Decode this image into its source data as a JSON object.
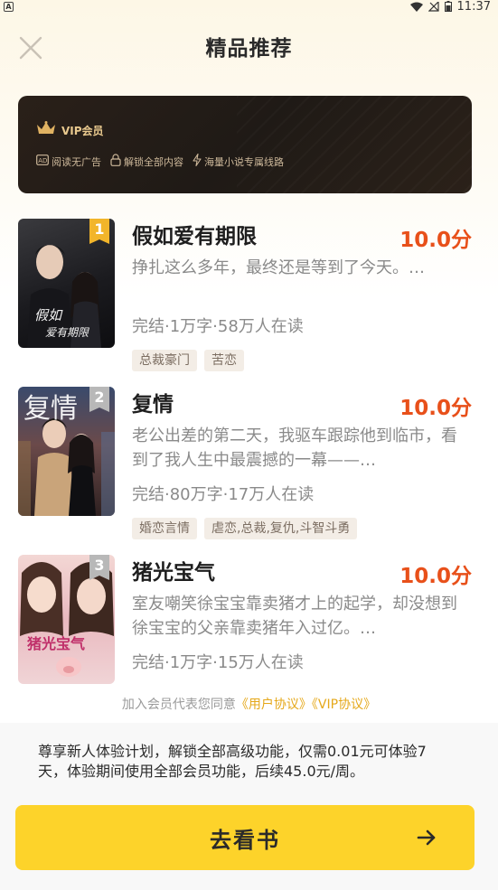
{
  "status_bar": {
    "time": "11:37",
    "notification_icon": "a-icon"
  },
  "header": {
    "title": "精品推荐",
    "close_icon": "close-icon"
  },
  "vip": {
    "title": "VIP会员",
    "perks": [
      {
        "icon": "ad-icon",
        "label": "阅读无广告"
      },
      {
        "icon": "lock-icon",
        "label": "解锁全部内容"
      },
      {
        "icon": "lightning-icon",
        "label": "海量小说专属线路"
      }
    ]
  },
  "books": [
    {
      "rank": "1",
      "title": "假如爱有期限",
      "score": "10.0分",
      "desc": "挣扎这么多年，最终还是等到了今天。…",
      "meta": "完结·1万字·58万人在读",
      "tags": [
        "总裁豪门",
        "苦恋"
      ],
      "cover_text": "假如爱有期限"
    },
    {
      "rank": "2",
      "title": "复情",
      "score": "10.0分",
      "desc": "老公出差的第二天，我驱车跟踪他到临市，看到了我人生中最震撼的一幕——…",
      "meta": "完结·80万字·17万人在读",
      "tags": [
        "婚恋言情",
        "虐恋,总裁,复仇,斗智斗勇"
      ],
      "cover_text": "复情"
    },
    {
      "rank": "3",
      "title": "猪光宝气",
      "score": "10.0分",
      "desc": "室友嘲笑徐宝宝靠卖猪才上的起学，却没想到徐宝宝的父亲靠卖猪年入过亿。…",
      "meta": "完结·1万字·15万人在读",
      "tags": [],
      "cover_text": "猪光宝气"
    }
  ],
  "agreement": {
    "prefix": "加入会员代表您同意",
    "user_agreement": "《用户协议》",
    "vip_agreement": "《VIP协议》"
  },
  "offer_text": "尊享新人体验计划，解锁全部高级功能，仅需0.01元可体验7天，体验期间使用全部会员功能，后续45.0元/周。",
  "cta": {
    "label": "去看书",
    "icon": "arrow-right-icon"
  },
  "colors": {
    "accent": "#fdd32a",
    "score": "#e8501a",
    "vip_gold": "#e9c98e",
    "rank1": "#f2b52a",
    "rank_other": "#b8b8b8"
  }
}
